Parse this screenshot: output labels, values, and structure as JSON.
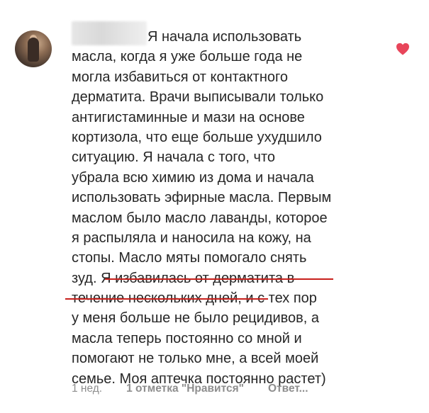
{
  "comment": {
    "lines": [
      "Я начала использовать",
      "масла, когда я уже больше года не",
      "могла избавиться от контактного",
      "дерматита. Врачи выписывали только",
      "антигистаминные и мази на основе",
      "кортизола, что еще больше ухудшило",
      "ситуацию. Я начала с того, что",
      "убрала всю химию из дома и начала",
      "использовать эфирные масла. Первым",
      "маслом было масло лаванды, которое",
      "я распыляла и наносила на кожу, на",
      "стопы. Масло мяты помогало снять",
      "зуд. Я избавилась от дерматита в",
      "течение нескольких дней, и с тех пор",
      "у меня больше не было рецидивов, а",
      "масла  теперь постоянно со мной и",
      "помогают не только мне, а всей моей",
      "семье. Моя аптечка постоянно растет)"
    ],
    "footer": {
      "time": "1 нед.",
      "likes": "1 отметка \"Нравится\"",
      "reply": "Ответ..."
    }
  },
  "colors": {
    "heart": "#e8455a",
    "underline": "#c8201c",
    "meta_text": "#8e8e8e"
  },
  "icons": {
    "like": "heart-icon"
  }
}
